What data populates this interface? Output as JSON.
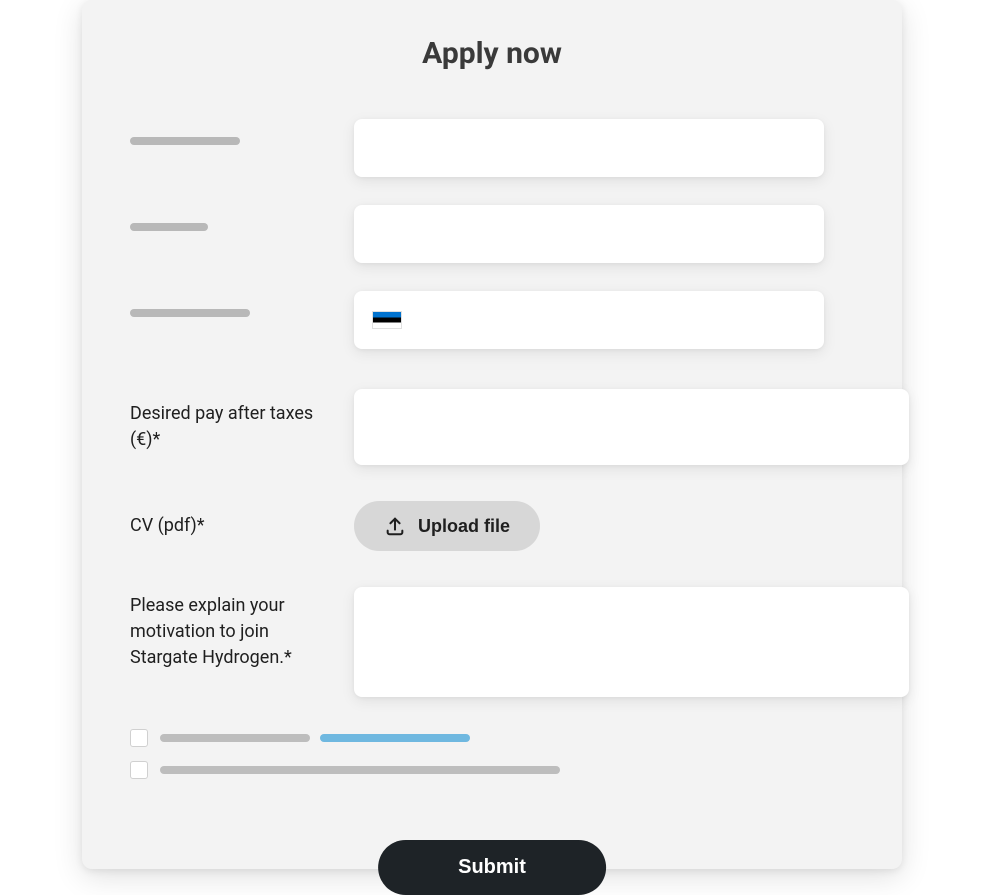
{
  "form": {
    "title": "Apply now",
    "fields": {
      "first": {
        "value": ""
      },
      "second": {
        "value": ""
      },
      "phone": {
        "country_icon": "estonia-flag",
        "value": ""
      },
      "desired_pay": {
        "label": "Desired pay after taxes (€)*",
        "value": ""
      },
      "cv": {
        "label": "CV (pdf)*",
        "button_label": "Upload file"
      },
      "motivation": {
        "label": "Please explain your motivation to join Stargate Hydrogen.*",
        "value": ""
      }
    },
    "checkboxes": {
      "cb1": {
        "checked": false
      },
      "cb2": {
        "checked": false
      }
    },
    "submit_label": "Submit"
  }
}
